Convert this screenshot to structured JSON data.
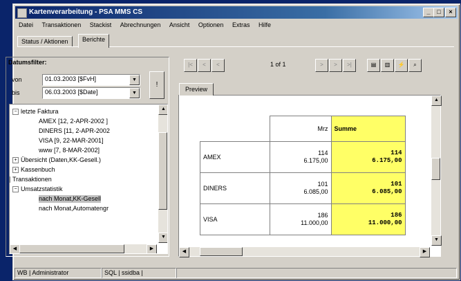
{
  "window": {
    "title": "Kartenverarbeitung - PSA MMS CS",
    "min": "_",
    "max": "□",
    "close": "×"
  },
  "menu": [
    "Datei",
    "Transaktionen",
    "Stackist",
    "Abrechnungen",
    "Ansicht",
    "Optionen",
    "Extras",
    "Hilfe"
  ],
  "tabs": {
    "status": "Status / Aktionen",
    "berichte": "Berichte"
  },
  "filter": {
    "title": "Datumsfilter:",
    "von_label": "von",
    "bis_label": "bis",
    "von_value": "01.03.2003 [$FvH]",
    "bis_value": "06.03.2003 [$Date]",
    "apply": "!"
  },
  "tree": {
    "letzte_faktura": "letzte Faktura",
    "amex": "AMEX [12, 2-APR-2002 ]",
    "diners": "DINERS [11, 2-APR-2002",
    "visa": "VISA [9, 22-MAR-2001]",
    "www": "www [7, 8-MAR-2002]",
    "uebersicht": "Übersicht (Daten,KK-Gesell.)",
    "kassenbuch": "Kassenbuch",
    "transaktionen": "Transaktionen",
    "umsatzstatistik": "Umsatzstatistik",
    "nach_kk": "nach Monat,KK-Gesell",
    "nach_auto": "nach Monat,Automatengr"
  },
  "nav": {
    "pageinfo": "1 of 1",
    "first": "|<",
    "prev": "<",
    "prev2": "<",
    "next": ">",
    "next2": ">",
    "last": ">|"
  },
  "preview_tab": "Preview",
  "report": {
    "header_mrz": "Mrz",
    "header_summe": "Summe",
    "rows": [
      {
        "name": "AMEX",
        "count": "114",
        "amount": "6.175,00",
        "sum_count": "114",
        "sum_amount": "6.175,00"
      },
      {
        "name": "DINERS",
        "count": "101",
        "amount": "6.085,00",
        "sum_count": "101",
        "sum_amount": "6.085,00"
      },
      {
        "name": "VISA",
        "count": "186",
        "amount": "11.000,00",
        "sum_count": "186",
        "sum_amount": "11.000,00"
      }
    ]
  },
  "status": {
    "user": "WB | Administrator",
    "db": "SQL | ssidba |"
  }
}
